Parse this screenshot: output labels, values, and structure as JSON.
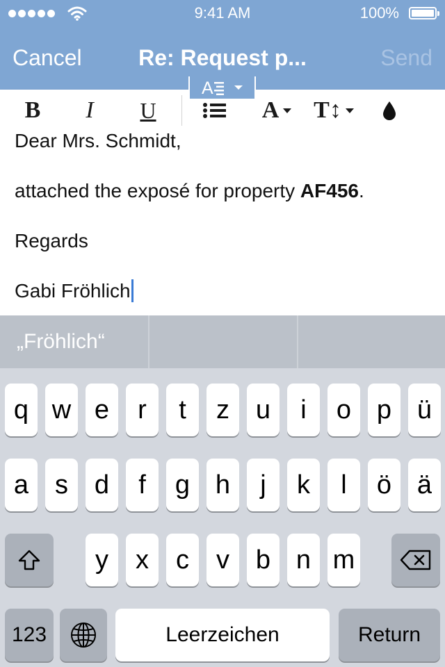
{
  "status_bar": {
    "time": "9:41 AM",
    "battery": "100%"
  },
  "nav": {
    "cancel": "Cancel",
    "title": "Re: Request p...",
    "send": "Send"
  },
  "toolbar": {
    "bold": "B",
    "italic": "I",
    "underline": "U",
    "color_glyph": "A",
    "size_glyph": "T↕"
  },
  "body": {
    "greeting": "Dear Mrs. Schmidt,",
    "message_prefix": "attached the exposé for property ",
    "property_id": "AF456",
    "message_suffix": ".",
    "closing": "Regards",
    "signature": "Gabi Fröhlich"
  },
  "predictive": {
    "suggestion_1": "„Fröhlich“",
    "suggestion_2": "",
    "suggestion_3": ""
  },
  "keyboard": {
    "row1": [
      "q",
      "w",
      "e",
      "r",
      "t",
      "z",
      "u",
      "i",
      "o",
      "p",
      "ü"
    ],
    "row2": [
      "a",
      "s",
      "d",
      "f",
      "g",
      "h",
      "j",
      "k",
      "l",
      "ö",
      "ä"
    ],
    "row3": [
      "y",
      "x",
      "c",
      "v",
      "b",
      "n",
      "m"
    ],
    "numbers_label": "123",
    "space_label": "Leerzeichen",
    "return_label": "Return"
  }
}
